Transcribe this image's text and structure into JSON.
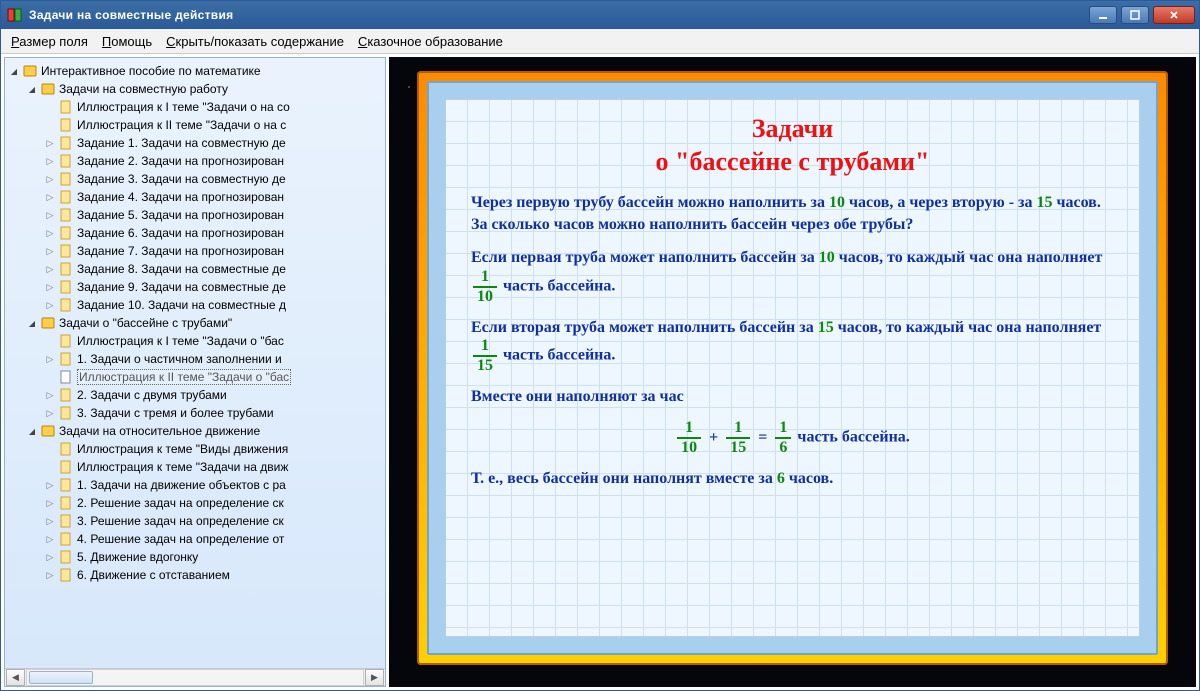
{
  "window": {
    "title": "Задачи на совместные действия"
  },
  "menu": {
    "i0": "Размер поля",
    "i1": "Помощь",
    "i2": "Скрыть/показать содержание",
    "i3": "Сказочное образование"
  },
  "tree": {
    "n0": "Интерактивное пособие по математике",
    "n1": "Задачи на совместную работу",
    "n1a": "Иллюстрация к I теме \"Задачи о на со",
    "n1b": "Иллюстрация к II теме \"Задачи о на с",
    "n1c": "Задание 1. Задачи на совместную де",
    "n1d": "Задание 2. Задачи на прогнозирован",
    "n1e": "Задание 3. Задачи на совместную де",
    "n1f": "Задание 4. Задачи на прогнозирован",
    "n1g": "Задание 5. Задачи на прогнозирован",
    "n1h": "Задание 6. Задачи на прогнозирован",
    "n1i": "Задание 7. Задачи на прогнозирован",
    "n1j": "Задание 8. Задачи на совместные де",
    "n1k": "Задание 9. Задачи на совместные де",
    "n1l": "Задание 10. Задачи на совместные д",
    "n2": "Задачи о \"бассейне с трубами\"",
    "n2a": "Иллюстрация к I теме \"Задачи о \"бас",
    "n2b": "1. Задачи о частичном заполнении и",
    "n2c": "Иллюстрация к II теме \"Задачи о \"бас",
    "n2d": "2. Задачи с двумя трубами",
    "n2e": "3. Задачи с тремя и более трубами",
    "n3": "Задачи на относительное движение",
    "n3a": "Иллюстрация к теме \"Виды движения",
    "n3b": "Иллюстрация к теме \"Задачи на движ",
    "n3c": "1. Задачи на движение объектов с ра",
    "n3d": "2. Решение задач на определение ск",
    "n3e": "3. Решение задач на определение ск",
    "n3f": "4. Решение задач на определение от",
    "n3g": "5. Движение вдогонку",
    "n3h": "6. Движение с отставанием"
  },
  "page": {
    "title_l1": "Задачи",
    "title_l2": "о \"бассейне с трубами\"",
    "p1_a": "Через первую трубу бассейн можно наполнить за ",
    "p1_n1": "10",
    "p1_b": " часов, а через вторую - за ",
    "p1_n2": "15",
    "p1_c": " часов. За сколько часов можно наполнить бассейн через обе трубы?",
    "p2_a": "Если первая труба может наполнить бассейн за ",
    "p2_n1": "10",
    "p2_b": " часов, то каждый час она наполняет ",
    "p2_c": " часть бассейна.",
    "p3_a": "Если вторая труба может наполнить бассейн за ",
    "p3_n1": "15",
    "p3_b": " часов, то каждый час она наполняет ",
    "p3_c": " часть бассейна.",
    "p4": "Вместе они наполняют за час",
    "eq_rest": "  часть бассейна.",
    "p5_a": "Т. е., весь бассейн они наполнят вместе за ",
    "p5_n": "6",
    "p5_b": " часов.",
    "f1n": "1",
    "f1d": "10",
    "f2n": "1",
    "f2d": "15",
    "f3n": "1",
    "f3d": "10",
    "f4n": "1",
    "f4d": "15",
    "f5n": "1",
    "f5d": "6"
  }
}
